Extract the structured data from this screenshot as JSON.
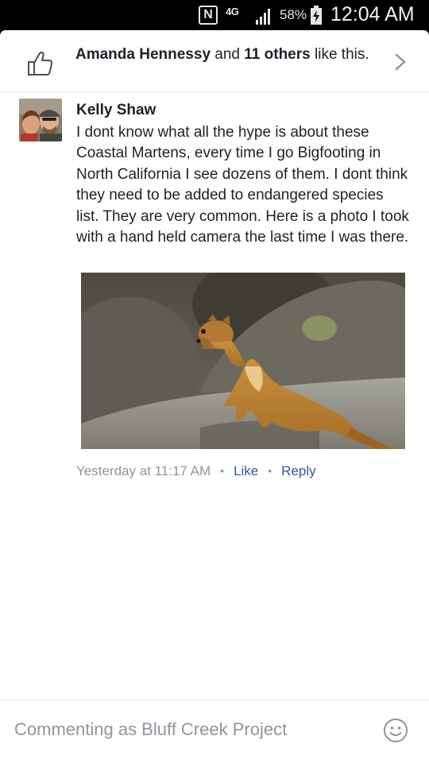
{
  "status_bar": {
    "nfc_label": "N",
    "network_label": "4G",
    "battery_pct": "58%",
    "time": "12:04 AM",
    "icons": [
      "nfc-icon",
      "signal-icon",
      "battery-charging-icon"
    ]
  },
  "likes": {
    "name": "Amanda Hennessy",
    "connector": " and ",
    "others": "11 others",
    "suffix": " like this.",
    "icons": [
      "thumbs-up-icon",
      "chevron-right-icon"
    ]
  },
  "comment": {
    "author": "Kelly Shaw",
    "text": "I dont know what all the hype is about these Coastal Martens, every time I go Bigfooting in North California I see dozens of them. I dont think they need to be added to endangered species list. They are very common. Here is a photo I took with a hand held camera the last time I was there.",
    "photo_subject": "weasel-on-rock",
    "timestamp": "Yesterday at 11:17 AM",
    "like_label": "Like",
    "reply_label": "Reply",
    "separator": "•"
  },
  "composer": {
    "placeholder": "Commenting as Bluff Creek Project",
    "icons": [
      "emoji-icon"
    ]
  },
  "colors": {
    "text": "#1d2129",
    "muted": "#90949c",
    "link": "#365899",
    "divider": "#e9eaed"
  }
}
